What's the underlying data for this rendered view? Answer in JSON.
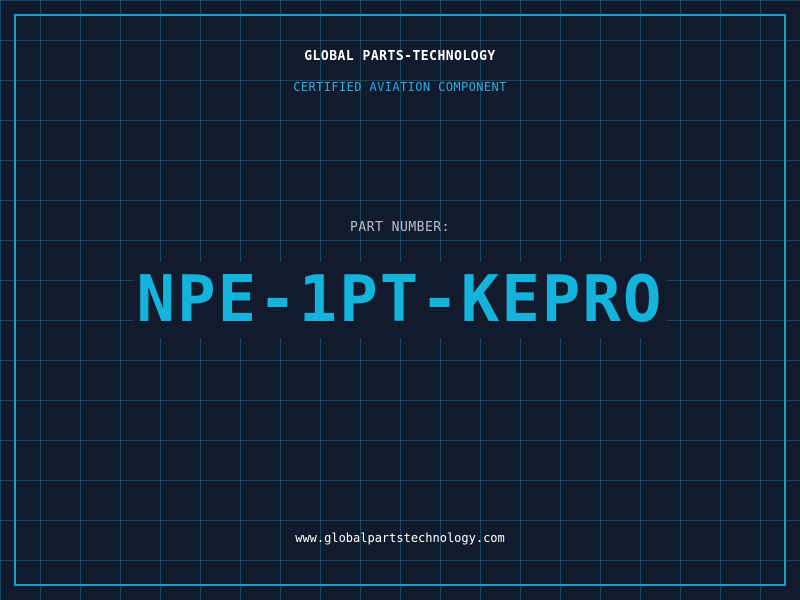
{
  "header": {
    "company": "GLOBAL PARTS-TECHNOLOGY",
    "subtitle": "CERTIFIED AVIATION COMPONENT"
  },
  "part": {
    "label": "PART NUMBER:",
    "number": "NPE-1PT-KEPRO"
  },
  "footer": {
    "website": "www.globalpartstechnology.com"
  },
  "colors": {
    "background": "#121a2e",
    "grid": "#176e8c",
    "frame": "#1c9fc4",
    "accent": "#13b3dc",
    "subtitle": "#29aee0",
    "label": "#b8c0cc",
    "text": "#ffffff"
  }
}
